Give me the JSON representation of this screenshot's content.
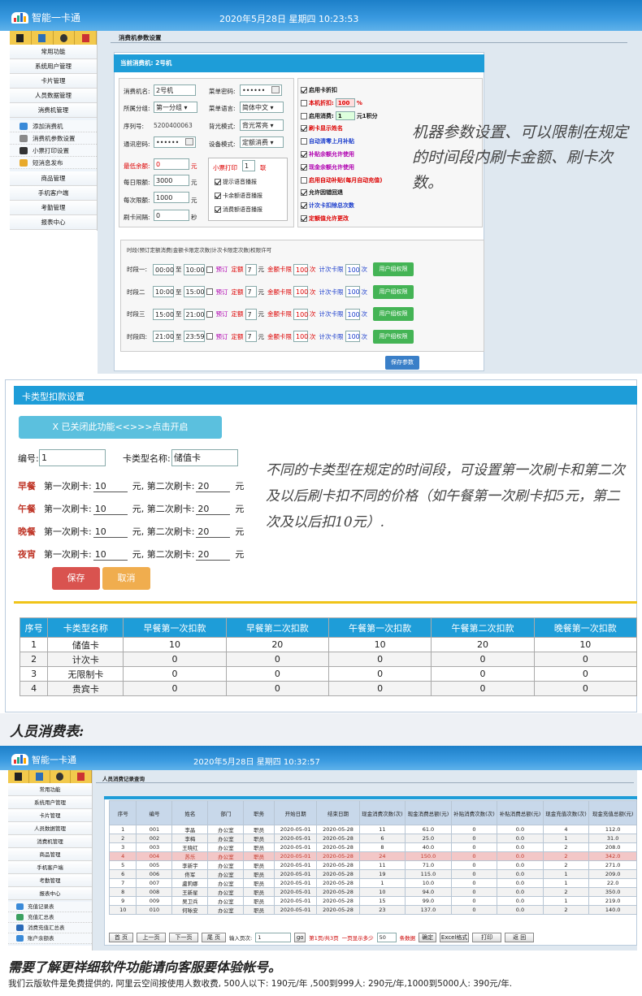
{
  "top1": {
    "logo": "智能一卡通",
    "datetime": "2020年5月28日 星期四 10:23:53"
  },
  "sidebar1": {
    "items": [
      "常用功能",
      "系统用户管理",
      "卡片管理",
      "人员数据管理",
      "消费机管理"
    ],
    "subitems": [
      {
        "label": "添加消费机",
        "icon": "add-device-icon"
      },
      {
        "label": "消费机参数设置",
        "icon": "gear-icon"
      },
      {
        "label": "小票打印设置",
        "icon": "printer-icon"
      },
      {
        "label": "短消息发布",
        "icon": "message-icon"
      }
    ],
    "items2": [
      "商品管理",
      "手机客户端",
      "考勤管理",
      "报表中心"
    ]
  },
  "machine": {
    "page_title": "消费机参数设置",
    "current_label": "当前消费机: 2号机",
    "name_label": "消费机名:",
    "name_value": "2号机",
    "menu_pwd_label": "菜单密码:",
    "menu_pwd_value": "••••••",
    "group_label": "所属分组:",
    "group_value": "第一分组",
    "lang_label": "菜单语言:",
    "lang_value": "简体中文",
    "serial_label": "序列号:",
    "serial_value": "5200400063",
    "backlight_label": "背光模式:",
    "backlight_value": "背光常亮",
    "comm_pwd_label": "通讯密码:",
    "comm_pwd_value": "••••••",
    "devmode_label": "设备模式:",
    "devmode_value": "定额消费",
    "min_balance_label": "最低余额:",
    "min_balance_value": "0",
    "unit_yuan": "元",
    "daily_limit_label": "每日限额:",
    "daily_limit_value": "3000",
    "per_limit_label": "每次限额:",
    "per_limit_value": "1000",
    "interval_label": "刷卡间隔:",
    "interval_value": "0",
    "unit_sec": "秒",
    "receipt_label": "小票打印",
    "receipt_value": "1",
    "receipt_unit": "联",
    "voice": [
      "提示语音播报",
      "卡余额语音播报",
      "消费额语音播报"
    ],
    "options": [
      {
        "label": "启用卡折扣",
        "color": "#111",
        "checked": true
      },
      {
        "label": "本机折扣:",
        "color": "#d00",
        "checked": false,
        "value": "100",
        "suffix": "%"
      },
      {
        "label": "启用消费:",
        "color": "#111",
        "checked": false,
        "value": "1",
        "suffix": "元1积分"
      },
      {
        "label": "刷卡显示姓名",
        "color": "#d00",
        "checked": true
      },
      {
        "label": "自动清零上月补贴",
        "color": "#1a3ccc",
        "checked": false
      },
      {
        "label": "补贴余额允许使用",
        "color": "#b000b0",
        "checked": true
      },
      {
        "label": "现金余额允许使用",
        "color": "#b000b0",
        "checked": true
      },
      {
        "label": "启用自动补贴(每月自动充值)",
        "color": "#d00",
        "checked": false
      },
      {
        "label": "允许因错回退",
        "color": "#111",
        "checked": true
      },
      {
        "label": "计次卡扣除总次数",
        "color": "#1a3ccc",
        "checked": true
      },
      {
        "label": "定额值允许更改",
        "color": "#d00",
        "checked": true
      }
    ],
    "period_header": "时段(预订定额消费|金额卡限定次数|计次卡限定次数|权限许可",
    "periods": [
      {
        "name": "时段一:",
        "start": "00:00",
        "end": "10:00",
        "amount": "7",
        "times": "100",
        "ctimes": "100"
      },
      {
        "name": "时段二",
        "start": "10:00",
        "end": "15:00",
        "amount": "7",
        "times": "100",
        "ctimes": "100"
      },
      {
        "name": "时段三",
        "start": "15:00",
        "end": "21:00",
        "amount": "7",
        "times": "100",
        "ctimes": "100"
      },
      {
        "name": "时段四:",
        "start": "21:00",
        "end": "23:59",
        "amount": "7",
        "times": "100",
        "ctimes": "100"
      }
    ],
    "to_label": "至",
    "book_label": "预订",
    "fixed_label": "定额",
    "money_limit_label": "金额卡限",
    "times_unit": "次",
    "count_limit_label": "计次卡限",
    "group_btn": "用户组权限",
    "save_btn": "保存参数",
    "caption": "机器参数设置、可以限制在规定的时间段内刷卡金额、刷卡次数。"
  },
  "cardtype": {
    "title": "卡类型扣款设置",
    "toggle_btn": "X 已关闭此功能<<>>>点击开启",
    "no_label": "编号:",
    "no_value": "1",
    "type_label": "卡类型名称:",
    "type_value": "储值卡",
    "meals": [
      {
        "name": "早餐",
        "first": "10",
        "second": "20"
      },
      {
        "name": "午餐",
        "first": "10",
        "second": "20"
      },
      {
        "name": "晚餐",
        "first": "10",
        "second": "20"
      },
      {
        "name": "夜宵",
        "first": "10",
        "second": "20"
      }
    ],
    "first_label": "第一次刷卡:",
    "second_label": "元, 第二次刷卡:",
    "yuan": "元",
    "save_btn": "保存",
    "cancel_btn": "取消",
    "caption": "不同的卡类型在规定的时间段，可设置第一次刷卡和第二次及以后刷卡扣不同的价格（如午餐第一次刷卡扣5元，第二次及以后扣10元）.",
    "table_headers": [
      "序号",
      "卡类型名称",
      "早餐第一次扣款",
      "早餐第二次扣款",
      "午餐第一次扣款",
      "午餐第二次扣款",
      "晚餐第一次扣款"
    ],
    "table_rows": [
      [
        "1",
        "储值卡",
        "10",
        "20",
        "10",
        "20",
        "10"
      ],
      [
        "2",
        "计次卡",
        "0",
        "0",
        "0",
        "0",
        "0"
      ],
      [
        "3",
        "无限制卡",
        "0",
        "0",
        "0",
        "0",
        "0"
      ],
      [
        "4",
        "贵宾卡",
        "0",
        "0",
        "0",
        "0",
        "0"
      ]
    ]
  },
  "section_label": "人员消费表:",
  "top2": {
    "logo": "智能一卡通",
    "datetime": "2020年5月28日 星期四 10:32:57"
  },
  "sidebar2": {
    "items": [
      "常用功能",
      "系统用户管理",
      "卡片管理",
      "人员数据管理",
      "消费机管理",
      "商品管理",
      "手机客户端",
      "考勤管理",
      "报表中心"
    ],
    "subitems": [
      "充值记录表",
      "充值汇总表",
      "消费充值汇总表",
      "账户余额表"
    ]
  },
  "report": {
    "title": "人员消费记录查询",
    "headers": [
      "序号",
      "编号",
      "姓名",
      "部门",
      "职务",
      "开始日期",
      "结束日期",
      "现金消费次数(次)",
      "现金消费总额(元)",
      "补贴消费次数(次)",
      "补贴消费总额(元)",
      "现金充值次数(次)",
      "现金充值总额(元)"
    ],
    "rows": [
      [
        "1",
        "001",
        "李晶",
        "办公室",
        "职员",
        "2020-05-01",
        "2020-05-28",
        "11",
        "61.0",
        "0",
        "0.0",
        "4",
        "112.0"
      ],
      [
        "2",
        "002",
        "李梅",
        "办公室",
        "职员",
        "2020-05-01",
        "2020-05-28",
        "6",
        "25.0",
        "0",
        "0.0",
        "1",
        "31.0"
      ],
      [
        "3",
        "003",
        "王晓红",
        "办公室",
        "职员",
        "2020-05-01",
        "2020-05-28",
        "8",
        "40.0",
        "0",
        "0.0",
        "2",
        "208.0"
      ],
      [
        "4",
        "004",
        "苏乐",
        "办公室",
        "职员",
        "2020-05-01",
        "2020-05-28",
        "24",
        "150.0",
        "0",
        "0.0",
        "2",
        "342.0"
      ],
      [
        "5",
        "005",
        "李新宇",
        "办公室",
        "职员",
        "2020-05-01",
        "2020-05-28",
        "11",
        "71.0",
        "0",
        "0.0",
        "2",
        "271.0"
      ],
      [
        "6",
        "006",
        "佟军",
        "办公室",
        "职员",
        "2020-05-01",
        "2020-05-28",
        "19",
        "115.0",
        "0",
        "0.0",
        "1",
        "209.0"
      ],
      [
        "7",
        "007",
        "盧莉娜",
        "办公室",
        "职员",
        "2020-05-01",
        "2020-05-28",
        "1",
        "10.0",
        "0",
        "0.0",
        "1",
        "22.0"
      ],
      [
        "8",
        "008",
        "王新星",
        "办公室",
        "职员",
        "2020-05-01",
        "2020-05-28",
        "10",
        "94.0",
        "0",
        "0.0",
        "2",
        "350.0"
      ],
      [
        "9",
        "009",
        "吴卫兵",
        "办公室",
        "职员",
        "2020-05-01",
        "2020-05-28",
        "15",
        "99.0",
        "0",
        "0.0",
        "1",
        "219.0"
      ],
      [
        "10",
        "010",
        "何咏安",
        "办公室",
        "职员",
        "2020-05-01",
        "2020-05-28",
        "23",
        "137.0",
        "0",
        "0.0",
        "2",
        "140.0"
      ]
    ],
    "pager": {
      "first": "首 页",
      "prev": "上一页",
      "next": "下一页",
      "last": "尾 页",
      "goto_label": "输入页次:",
      "goto_value": "1",
      "go": "go",
      "page_info": "第1页/共3页",
      "size_label": "一页显示多少",
      "size_value": "50",
      "size_unit": "条数据",
      "confirm": "确定",
      "excel": "Excel格式",
      "print": "打印",
      "back": "返 回"
    }
  },
  "footer": {
    "headline": "需要了解更祥细软件功能请向客服要体验帐号。",
    "note": "我们云版软件是免费提供的, 阿里云空间按使用人数收费, 500人以下: 190元/年 ,500到999人: 290元/年,1000到5000人: 390元/年."
  }
}
